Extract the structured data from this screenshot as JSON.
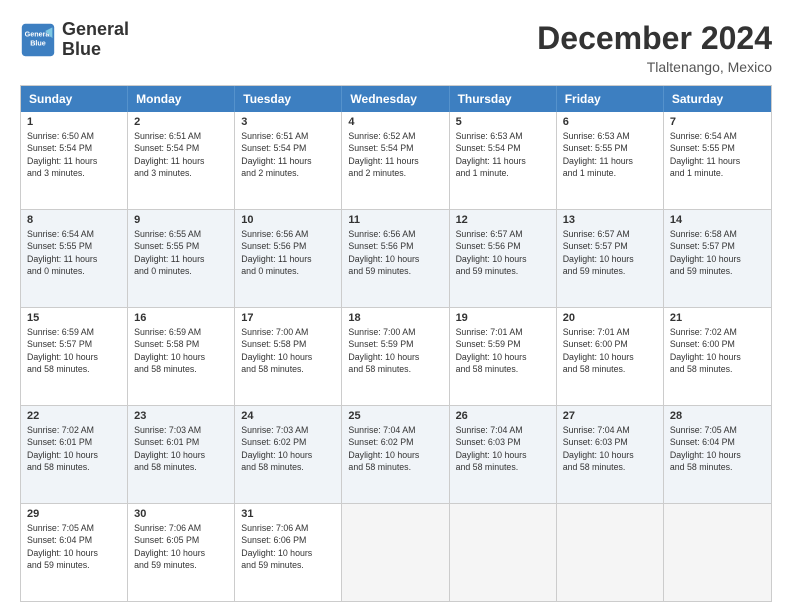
{
  "logo": {
    "line1": "General",
    "line2": "Blue"
  },
  "title": "December 2024",
  "location": "Tlaltenango, Mexico",
  "days_of_week": [
    "Sunday",
    "Monday",
    "Tuesday",
    "Wednesday",
    "Thursday",
    "Friday",
    "Saturday"
  ],
  "weeks": [
    [
      {
        "day": "1",
        "info": "Sunrise: 6:50 AM\nSunset: 5:54 PM\nDaylight: 11 hours\nand 3 minutes."
      },
      {
        "day": "2",
        "info": "Sunrise: 6:51 AM\nSunset: 5:54 PM\nDaylight: 11 hours\nand 3 minutes."
      },
      {
        "day": "3",
        "info": "Sunrise: 6:51 AM\nSunset: 5:54 PM\nDaylight: 11 hours\nand 2 minutes."
      },
      {
        "day": "4",
        "info": "Sunrise: 6:52 AM\nSunset: 5:54 PM\nDaylight: 11 hours\nand 2 minutes."
      },
      {
        "day": "5",
        "info": "Sunrise: 6:53 AM\nSunset: 5:54 PM\nDaylight: 11 hours\nand 1 minute."
      },
      {
        "day": "6",
        "info": "Sunrise: 6:53 AM\nSunset: 5:55 PM\nDaylight: 11 hours\nand 1 minute."
      },
      {
        "day": "7",
        "info": "Sunrise: 6:54 AM\nSunset: 5:55 PM\nDaylight: 11 hours\nand 1 minute."
      }
    ],
    [
      {
        "day": "8",
        "info": "Sunrise: 6:54 AM\nSunset: 5:55 PM\nDaylight: 11 hours\nand 0 minutes."
      },
      {
        "day": "9",
        "info": "Sunrise: 6:55 AM\nSunset: 5:55 PM\nDaylight: 11 hours\nand 0 minutes."
      },
      {
        "day": "10",
        "info": "Sunrise: 6:56 AM\nSunset: 5:56 PM\nDaylight: 11 hours\nand 0 minutes."
      },
      {
        "day": "11",
        "info": "Sunrise: 6:56 AM\nSunset: 5:56 PM\nDaylight: 10 hours\nand 59 minutes."
      },
      {
        "day": "12",
        "info": "Sunrise: 6:57 AM\nSunset: 5:56 PM\nDaylight: 10 hours\nand 59 minutes."
      },
      {
        "day": "13",
        "info": "Sunrise: 6:57 AM\nSunset: 5:57 PM\nDaylight: 10 hours\nand 59 minutes."
      },
      {
        "day": "14",
        "info": "Sunrise: 6:58 AM\nSunset: 5:57 PM\nDaylight: 10 hours\nand 59 minutes."
      }
    ],
    [
      {
        "day": "15",
        "info": "Sunrise: 6:59 AM\nSunset: 5:57 PM\nDaylight: 10 hours\nand 58 minutes."
      },
      {
        "day": "16",
        "info": "Sunrise: 6:59 AM\nSunset: 5:58 PM\nDaylight: 10 hours\nand 58 minutes."
      },
      {
        "day": "17",
        "info": "Sunrise: 7:00 AM\nSunset: 5:58 PM\nDaylight: 10 hours\nand 58 minutes."
      },
      {
        "day": "18",
        "info": "Sunrise: 7:00 AM\nSunset: 5:59 PM\nDaylight: 10 hours\nand 58 minutes."
      },
      {
        "day": "19",
        "info": "Sunrise: 7:01 AM\nSunset: 5:59 PM\nDaylight: 10 hours\nand 58 minutes."
      },
      {
        "day": "20",
        "info": "Sunrise: 7:01 AM\nSunset: 6:00 PM\nDaylight: 10 hours\nand 58 minutes."
      },
      {
        "day": "21",
        "info": "Sunrise: 7:02 AM\nSunset: 6:00 PM\nDaylight: 10 hours\nand 58 minutes."
      }
    ],
    [
      {
        "day": "22",
        "info": "Sunrise: 7:02 AM\nSunset: 6:01 PM\nDaylight: 10 hours\nand 58 minutes."
      },
      {
        "day": "23",
        "info": "Sunrise: 7:03 AM\nSunset: 6:01 PM\nDaylight: 10 hours\nand 58 minutes."
      },
      {
        "day": "24",
        "info": "Sunrise: 7:03 AM\nSunset: 6:02 PM\nDaylight: 10 hours\nand 58 minutes."
      },
      {
        "day": "25",
        "info": "Sunrise: 7:04 AM\nSunset: 6:02 PM\nDaylight: 10 hours\nand 58 minutes."
      },
      {
        "day": "26",
        "info": "Sunrise: 7:04 AM\nSunset: 6:03 PM\nDaylight: 10 hours\nand 58 minutes."
      },
      {
        "day": "27",
        "info": "Sunrise: 7:04 AM\nSunset: 6:03 PM\nDaylight: 10 hours\nand 58 minutes."
      },
      {
        "day": "28",
        "info": "Sunrise: 7:05 AM\nSunset: 6:04 PM\nDaylight: 10 hours\nand 58 minutes."
      }
    ],
    [
      {
        "day": "29",
        "info": "Sunrise: 7:05 AM\nSunset: 6:04 PM\nDaylight: 10 hours\nand 59 minutes."
      },
      {
        "day": "30",
        "info": "Sunrise: 7:06 AM\nSunset: 6:05 PM\nDaylight: 10 hours\nand 59 minutes."
      },
      {
        "day": "31",
        "info": "Sunrise: 7:06 AM\nSunset: 6:06 PM\nDaylight: 10 hours\nand 59 minutes."
      },
      {
        "day": "",
        "info": ""
      },
      {
        "day": "",
        "info": ""
      },
      {
        "day": "",
        "info": ""
      },
      {
        "day": "",
        "info": ""
      }
    ]
  ]
}
